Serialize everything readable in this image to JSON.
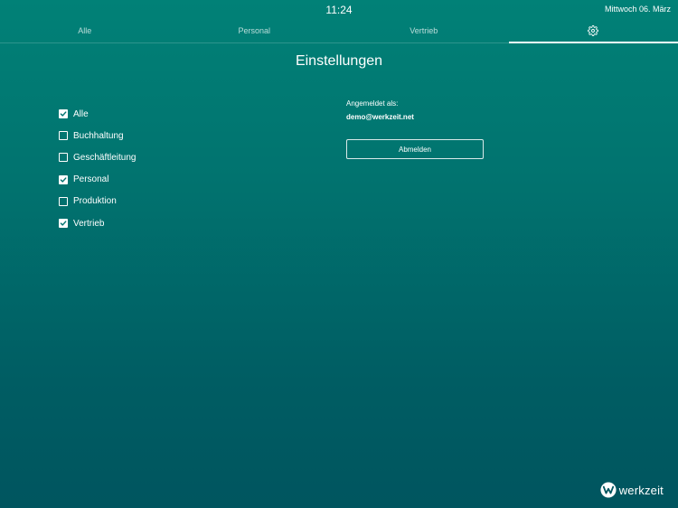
{
  "status_bar": {
    "time": "11:24",
    "date": "Mittwoch 06. März"
  },
  "tabs": [
    {
      "label": "Alle",
      "active": false
    },
    {
      "label": "Personal",
      "active": false
    },
    {
      "label": "Vertrieb",
      "active": false
    },
    {
      "label": "",
      "icon": "gear-icon",
      "active": true
    }
  ],
  "page_title": "Einstellungen",
  "filters": [
    {
      "label": "Alle",
      "checked": true
    },
    {
      "label": "Buchhaltung",
      "checked": false
    },
    {
      "label": "Geschäftleitung",
      "checked": false
    },
    {
      "label": "Personal",
      "checked": true
    },
    {
      "label": "Produktion",
      "checked": false
    },
    {
      "label": "Vertrieb",
      "checked": true
    }
  ],
  "account": {
    "caption": "Angemeldet als:",
    "email": "demo@werkzeit.net",
    "logout_label": "Abmelden"
  },
  "logo": {
    "text": "werkzeit",
    "icon": "werkzeit-logo-icon"
  },
  "colors": {
    "background_top": "#018177",
    "background_bottom": "#00555f",
    "foreground": "#ffffff"
  }
}
